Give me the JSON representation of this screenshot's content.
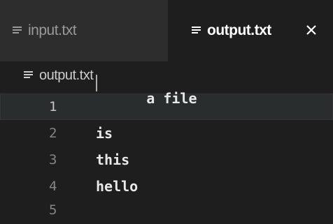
{
  "tabs": [
    {
      "label": "input.txt",
      "active": false
    },
    {
      "label": "output.txt",
      "active": true
    }
  ],
  "close_symbol": "✕",
  "breadcrumb": {
    "file": "output.txt"
  },
  "editor": {
    "current_line": 1,
    "lines": [
      {
        "number": "1",
        "text": "a file"
      },
      {
        "number": "2",
        "text": "is"
      },
      {
        "number": "3",
        "text": "this"
      },
      {
        "number": "4",
        "text": "hello"
      },
      {
        "number": "5",
        "text": ""
      }
    ]
  },
  "icons": {
    "file": "file-lines-icon",
    "close": "close-icon"
  },
  "colors": {
    "background": "#1e1e1e",
    "tabbar": "#252526",
    "inactive_tab": "#2d2d2d",
    "current_line": "#2a2d2e"
  }
}
